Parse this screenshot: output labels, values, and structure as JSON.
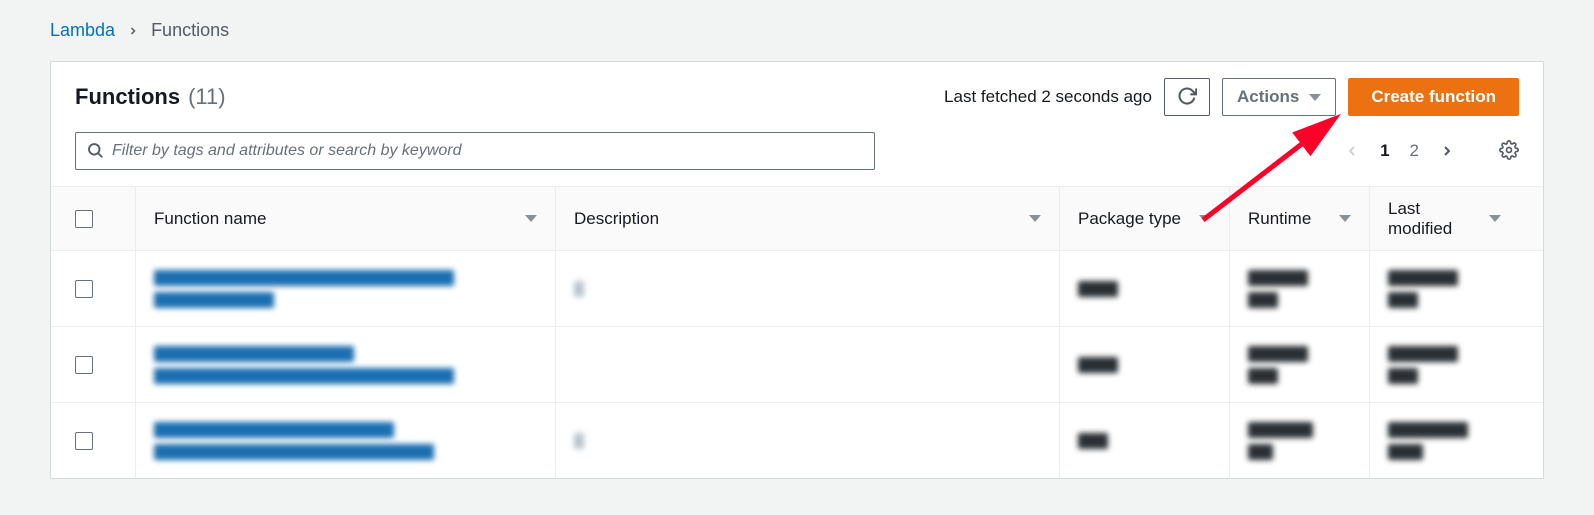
{
  "breadcrumb": {
    "root": "Lambda",
    "current": "Functions"
  },
  "header": {
    "title": "Functions",
    "count": "(11)",
    "last_fetched": "Last fetched 2 seconds ago",
    "actions_label": "Actions",
    "create_label": "Create function"
  },
  "search": {
    "placeholder": "Filter by tags and attributes or search by keyword"
  },
  "pagination": {
    "pages": [
      "1",
      "2"
    ],
    "active_index": 0
  },
  "columns": {
    "name": "Function name",
    "description": "Description",
    "package": "Package type",
    "runtime": "Runtime",
    "modified": "Last modified"
  }
}
